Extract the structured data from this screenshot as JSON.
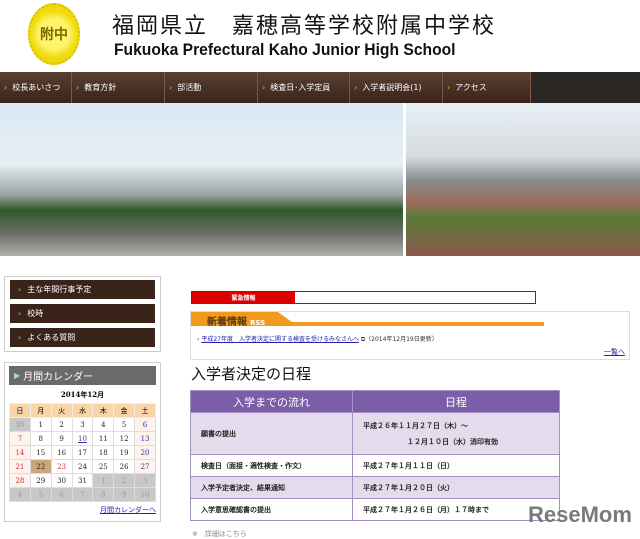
{
  "header": {
    "logo_text": "附中",
    "title_jp": "福岡県立　嘉穂高等学校附属中学校",
    "title_en": "Fukuoka Prefectural Kaho Junior High School"
  },
  "nav": [
    "校長あいさつ",
    "教育方針",
    "部活動",
    "検査日･入学定員",
    "入学者説明会(1)",
    "アクセス"
  ],
  "sidebar": {
    "links": [
      "主な年間行事予定",
      "校時",
      "よくある質問"
    ]
  },
  "calendar": {
    "title": "月間カレンダー",
    "month": "2014年12月",
    "weekdays": [
      "日",
      "月",
      "火",
      "水",
      "木",
      "金",
      "土"
    ],
    "weeks": [
      [
        "30",
        "1",
        "2",
        "3",
        "4",
        "5",
        "6"
      ],
      [
        "7",
        "8",
        "9",
        "10",
        "11",
        "12",
        "13"
      ],
      [
        "14",
        "15",
        "16",
        "17",
        "18",
        "19",
        "20"
      ],
      [
        "21",
        "22",
        "23",
        "24",
        "25",
        "26",
        "27"
      ],
      [
        "28",
        "29",
        "30",
        "31",
        "1",
        "2",
        "3"
      ],
      [
        "4",
        "5",
        "6",
        "7",
        "8",
        "9",
        "10"
      ]
    ],
    "link": "月間カレンダーへ"
  },
  "alert": {
    "label": "緊急情報"
  },
  "news": {
    "title": "新着情報",
    "rss": "RSS",
    "item_link": "平成27年度　入学者決定に関する検査を受けるみなさんへ",
    "item_date": "（2014年12月19日更新）",
    "more": "一覧へ"
  },
  "schedule": {
    "heading": "入学者決定の日程",
    "headers": [
      "入学までの流れ",
      "日程"
    ],
    "rows": [
      {
        "step": "願書の提出",
        "date": "平成２６年１１月２７日（木）～",
        "date2": "１２月１０日（水）消印有効"
      },
      {
        "step": "検査日（面接・適性検査・作文）",
        "date": "平成２７年１月１１日（日）"
      },
      {
        "step": "入学予定者決定、結果通知",
        "date": "平成２７年１月２０日（火）"
      },
      {
        "step": "入学意思確認書の提出",
        "date": "平成２７年１月２６日（月）１７時まで"
      }
    ]
  },
  "footnote": "※　詳細はこちら",
  "watermark": "ReseMom"
}
